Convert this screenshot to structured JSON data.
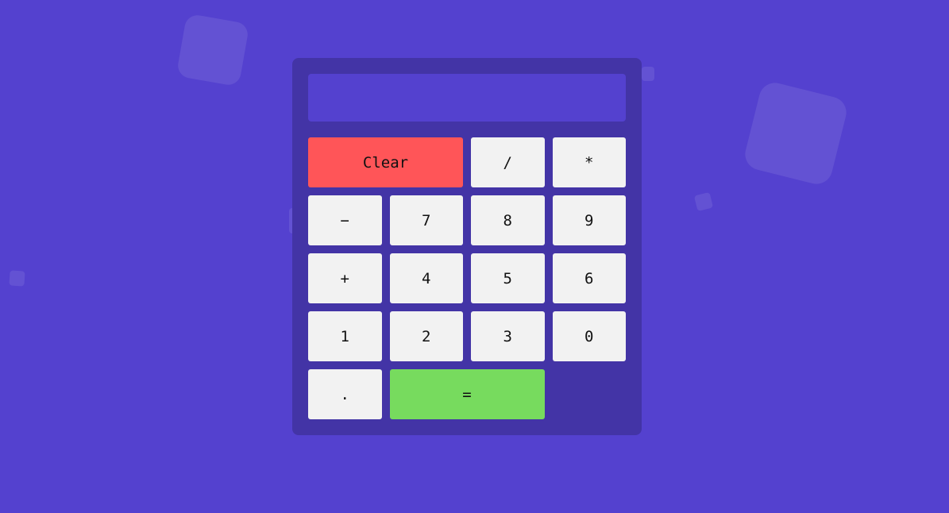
{
  "display": {
    "value": "",
    "placeholder": ""
  },
  "colors": {
    "background": "#5441cf",
    "panel": "#4334a6",
    "key": "#f2f2f2",
    "clear": "#ff5558",
    "equals": "#77db5e"
  },
  "keys": {
    "clear": "Clear",
    "divide": "/",
    "multiply": "*",
    "subtract": "−",
    "seven": "7",
    "eight": "8",
    "nine": "9",
    "add": "+",
    "four": "4",
    "five": "5",
    "six": "6",
    "one": "1",
    "two": "2",
    "three": "3",
    "zero": "0",
    "decimal": ".",
    "equals": "="
  }
}
